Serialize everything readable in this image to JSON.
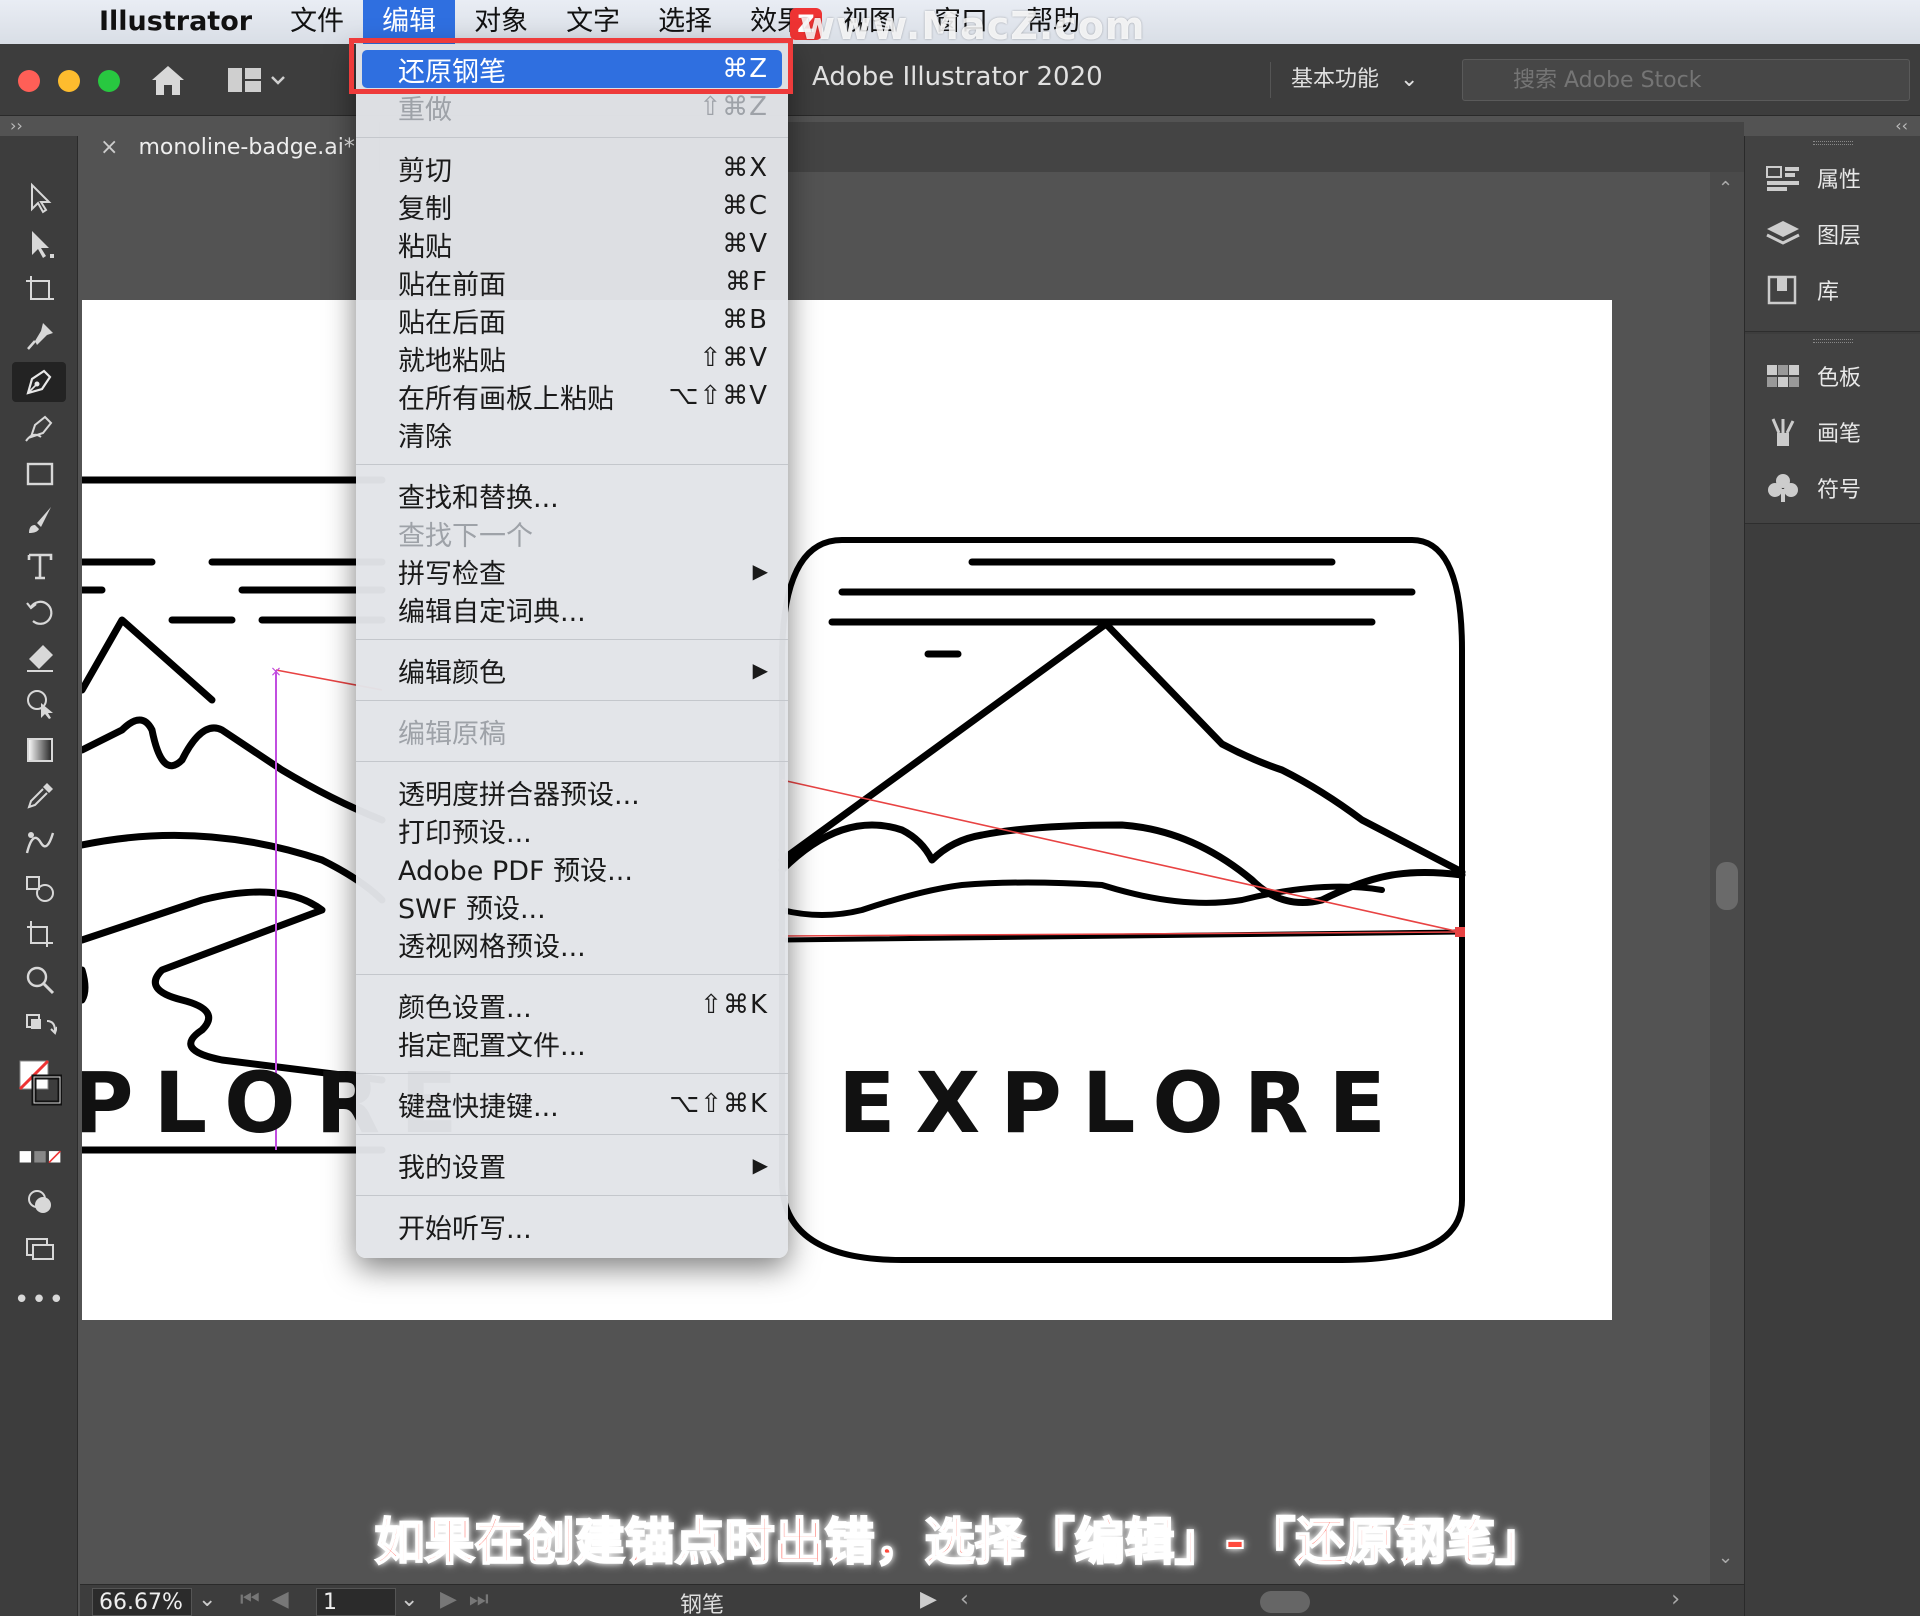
{
  "menubar": {
    "app": "Illustrator",
    "items": [
      "文件",
      "编辑",
      "对象",
      "文字",
      "选择",
      "效果",
      "视图",
      "窗口",
      "帮助"
    ],
    "active_index": 1,
    "watermark": "www.MacZ.com",
    "watermark_badge": "Z"
  },
  "appbar": {
    "title": "Adobe Illustrator 2020",
    "workspace": "基本功能",
    "search_placeholder": "搜索 Adobe Stock"
  },
  "document": {
    "tab_label": "monoline-badge.ai*",
    "artwork_text_left": "PLORE",
    "artwork_text_right": "EXPLORE"
  },
  "edit_menu": {
    "groups": [
      [
        {
          "label": "还原钢笔",
          "shortcut": "⌘Z",
          "state": "highlighted"
        },
        {
          "label": "重做",
          "shortcut": "⇧⌘Z",
          "state": "disabled"
        }
      ],
      [
        {
          "label": "剪切",
          "shortcut": "⌘X"
        },
        {
          "label": "复制",
          "shortcut": "⌘C"
        },
        {
          "label": "粘贴",
          "shortcut": "⌘V"
        },
        {
          "label": "贴在前面",
          "shortcut": "⌘F"
        },
        {
          "label": "贴在后面",
          "shortcut": "⌘B"
        },
        {
          "label": "就地粘贴",
          "shortcut": "⇧⌘V"
        },
        {
          "label": "在所有画板上粘贴",
          "shortcut": "⌥⇧⌘V"
        },
        {
          "label": "清除",
          "shortcut": ""
        }
      ],
      [
        {
          "label": "查找和替换...",
          "shortcut": ""
        },
        {
          "label": "查找下一个",
          "shortcut": "",
          "state": "disabled"
        },
        {
          "label": "拼写检查",
          "shortcut": "",
          "submenu": true
        },
        {
          "label": "编辑自定词典...",
          "shortcut": ""
        }
      ],
      [
        {
          "label": "编辑颜色",
          "shortcut": "",
          "submenu": true
        }
      ],
      [
        {
          "label": "编辑原稿",
          "shortcut": "",
          "state": "disabled"
        }
      ],
      [
        {
          "label": "透明度拼合器预设...",
          "shortcut": ""
        },
        {
          "label": "打印预设...",
          "shortcut": ""
        },
        {
          "label": "Adobe PDF 预设...",
          "shortcut": ""
        },
        {
          "label": "SWF 预设...",
          "shortcut": ""
        },
        {
          "label": "透视网格预设...",
          "shortcut": ""
        }
      ],
      [
        {
          "label": "颜色设置...",
          "shortcut": "⇧⌘K"
        },
        {
          "label": "指定配置文件...",
          "shortcut": ""
        }
      ],
      [
        {
          "label": "键盘快捷键...",
          "shortcut": "⌥⇧⌘K"
        }
      ],
      [
        {
          "label": "我的设置",
          "shortcut": "",
          "submenu": true
        }
      ],
      [
        {
          "label": "开始听写...",
          "shortcut": ""
        }
      ]
    ],
    "submenu_arrow": "▶"
  },
  "right_panel": {
    "group1": [
      {
        "label": "属性",
        "icon": "properties-icon"
      },
      {
        "label": "图层",
        "icon": "layers-icon"
      },
      {
        "label": "库",
        "icon": "libraries-icon"
      }
    ],
    "group2": [
      {
        "label": "色板",
        "icon": "swatches-icon"
      },
      {
        "label": "画笔",
        "icon": "brushes-icon"
      },
      {
        "label": "符号",
        "icon": "symbols-icon"
      }
    ]
  },
  "statusbar": {
    "zoom": "66.67%",
    "artboard": "1",
    "current_tool": "钢笔"
  },
  "caption": "如果在创建锚点时出错，选择「编辑」-「还原钢笔」",
  "colors": {
    "menu_highlight": "#2f6fe0",
    "callout_red": "#ee3b3b",
    "caption_red": "#ff4a3d",
    "ui_dark": "#3d3d3d",
    "canvas_bg": "#535353"
  }
}
